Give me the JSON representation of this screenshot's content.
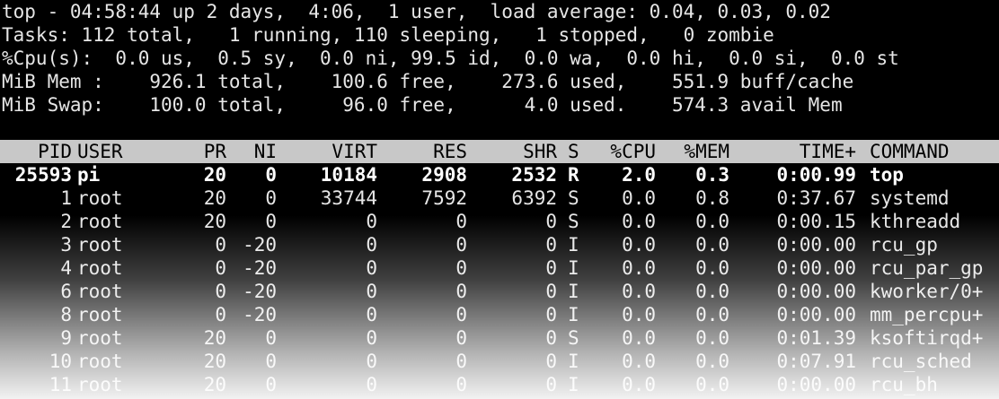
{
  "summary": {
    "line1": "top - 04:58:44 up 2 days,  4:06,  1 user,  load average: 0.04, 0.03, 0.02",
    "line2": "Tasks: 112 total,   1 running, 110 sleeping,   1 stopped,   0 zombie",
    "line3": "%Cpu(s):  0.0 us,  0.5 sy,  0.0 ni, 99.5 id,  0.0 wa,  0.0 hi,  0.0 si,  0.0 st",
    "line4": "MiB Mem :    926.1 total,    100.6 free,    273.6 used,    551.9 buff/cache",
    "line5": "MiB Swap:    100.0 total,     96.0 free,      4.0 used.    574.3 avail Mem"
  },
  "columns": {
    "pid": "PID",
    "user": "USER",
    "pr": "PR",
    "ni": "NI",
    "virt": "VIRT",
    "res": "RES",
    "shr": "SHR",
    "s": "S",
    "cpu": "%CPU",
    "mem": "%MEM",
    "time": "TIME+",
    "command": "COMMAND"
  },
  "processes": [
    {
      "pid": "25593",
      "user": "pi",
      "pr": "20",
      "ni": "0",
      "virt": "10184",
      "res": "2908",
      "shr": "2532",
      "s": "R",
      "cpu": "2.0",
      "mem": "0.3",
      "time": "0:00.99",
      "command": "top"
    },
    {
      "pid": "1",
      "user": "root",
      "pr": "20",
      "ni": "0",
      "virt": "33744",
      "res": "7592",
      "shr": "6392",
      "s": "S",
      "cpu": "0.0",
      "mem": "0.8",
      "time": "0:37.67",
      "command": "systemd"
    },
    {
      "pid": "2",
      "user": "root",
      "pr": "20",
      "ni": "0",
      "virt": "0",
      "res": "0",
      "shr": "0",
      "s": "S",
      "cpu": "0.0",
      "mem": "0.0",
      "time": "0:00.15",
      "command": "kthreadd"
    },
    {
      "pid": "3",
      "user": "root",
      "pr": "0",
      "ni": "-20",
      "virt": "0",
      "res": "0",
      "shr": "0",
      "s": "I",
      "cpu": "0.0",
      "mem": "0.0",
      "time": "0:00.00",
      "command": "rcu_gp"
    },
    {
      "pid": "4",
      "user": "root",
      "pr": "0",
      "ni": "-20",
      "virt": "0",
      "res": "0",
      "shr": "0",
      "s": "I",
      "cpu": "0.0",
      "mem": "0.0",
      "time": "0:00.00",
      "command": "rcu_par_gp"
    },
    {
      "pid": "6",
      "user": "root",
      "pr": "0",
      "ni": "-20",
      "virt": "0",
      "res": "0",
      "shr": "0",
      "s": "I",
      "cpu": "0.0",
      "mem": "0.0",
      "time": "0:00.00",
      "command": "kworker/0+"
    },
    {
      "pid": "8",
      "user": "root",
      "pr": "0",
      "ni": "-20",
      "virt": "0",
      "res": "0",
      "shr": "0",
      "s": "I",
      "cpu": "0.0",
      "mem": "0.0",
      "time": "0:00.00",
      "command": "mm_percpu+"
    },
    {
      "pid": "9",
      "user": "root",
      "pr": "20",
      "ni": "0",
      "virt": "0",
      "res": "0",
      "shr": "0",
      "s": "S",
      "cpu": "0.0",
      "mem": "0.0",
      "time": "0:01.39",
      "command": "ksoftirqd+"
    },
    {
      "pid": "10",
      "user": "root",
      "pr": "20",
      "ni": "0",
      "virt": "0",
      "res": "0",
      "shr": "0",
      "s": "I",
      "cpu": "0.0",
      "mem": "0.0",
      "time": "0:07.91",
      "command": "rcu_sched"
    },
    {
      "pid": "11",
      "user": "root",
      "pr": "20",
      "ni": "0",
      "virt": "0",
      "res": "0",
      "shr": "0",
      "s": "I",
      "cpu": "0.0",
      "mem": "0.0",
      "time": "0:00.00",
      "command": "rcu_bh"
    }
  ],
  "colors": {
    "background": "#000000",
    "text": "#e6e6e6",
    "header_bg": "#c8c8c8",
    "header_text": "#000000"
  }
}
